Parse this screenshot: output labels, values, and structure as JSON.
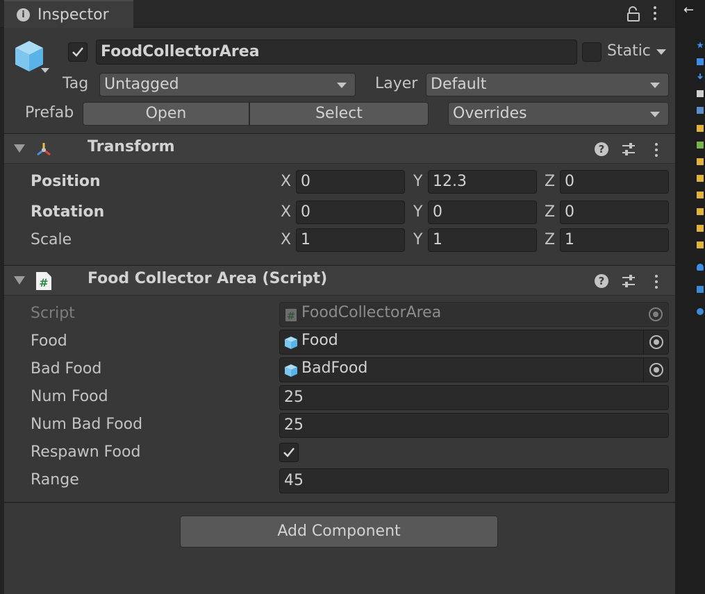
{
  "tab": {
    "label": "Inspector"
  },
  "header": {
    "object_name": "FoodCollectorArea",
    "active": true,
    "static_label": "Static",
    "tag_label": "Tag",
    "tag_value": "Untagged",
    "layer_label": "Layer",
    "layer_value": "Default",
    "prefab_label": "Prefab",
    "open_button": "Open",
    "select_button": "Select",
    "overrides_value": "Overrides"
  },
  "transform": {
    "title": "Transform",
    "rows": [
      {
        "label": "Position",
        "x": "0",
        "y": "12.3",
        "z": "0"
      },
      {
        "label": "Rotation",
        "x": "0",
        "y": "0",
        "z": "0"
      },
      {
        "label": "Scale",
        "x": "1",
        "y": "1",
        "z": "1"
      }
    ],
    "axes": {
      "x": "X",
      "y": "Y",
      "z": "Z"
    }
  },
  "script_component": {
    "title": "Food Collector Area (Script)",
    "script_label": "Script",
    "script_value": "FoodCollectorArea",
    "food_label": "Food",
    "food_value": "Food",
    "bad_food_label": "Bad Food",
    "bad_food_value": "BadFood",
    "num_food_label": "Num Food",
    "num_food_value": "25",
    "num_bad_food_label": "Num Bad Food",
    "num_bad_food_value": "25",
    "respawn_food_label": "Respawn Food",
    "respawn_food_checked": true,
    "range_label": "Range",
    "range_value": "45"
  },
  "add_component_label": "Add Component",
  "side_strip": {
    "back_arrow": "←"
  },
  "colors": {
    "panel_bg": "#383838",
    "field_bg": "#2a2a2a",
    "button_bg": "#585858",
    "cube_blue": "#7cc6ef",
    "accent_blue": "#3d8ee8"
  }
}
